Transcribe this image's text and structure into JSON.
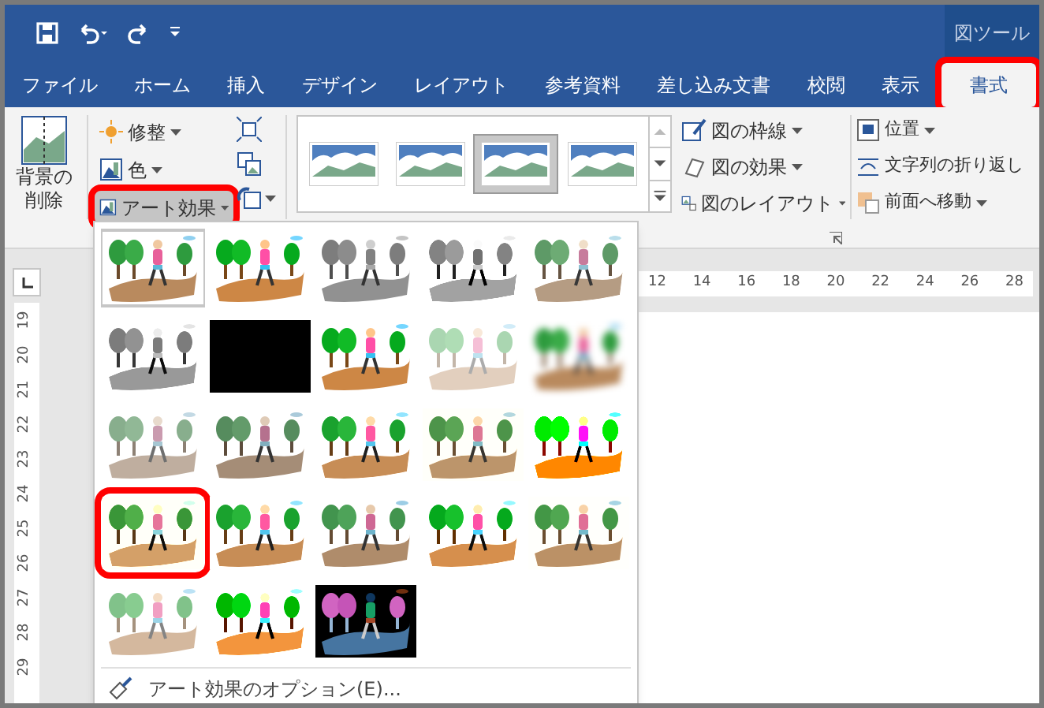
{
  "context_tab_group": "図ツール",
  "tabs": [
    {
      "label": "ファイル",
      "selected": false,
      "highlighted": false
    },
    {
      "label": "ホーム",
      "selected": false,
      "highlighted": false
    },
    {
      "label": "挿入",
      "selected": false,
      "highlighted": false
    },
    {
      "label": "デザイン",
      "selected": false,
      "highlighted": false
    },
    {
      "label": "レイアウト",
      "selected": false,
      "highlighted": false
    },
    {
      "label": "参考資料",
      "selected": false,
      "highlighted": false
    },
    {
      "label": "差し込み文書",
      "selected": false,
      "highlighted": false
    },
    {
      "label": "校閲",
      "selected": false,
      "highlighted": false
    },
    {
      "label": "表示",
      "selected": false,
      "highlighted": false
    },
    {
      "label": "書式",
      "selected": true,
      "highlighted": true
    }
  ],
  "ribbon": {
    "remove_background": [
      "背景の",
      "削除"
    ],
    "adjust": [
      {
        "label": "修整",
        "pressed": false,
        "highlighted": false
      },
      {
        "label": "色",
        "pressed": false,
        "highlighted": false
      },
      {
        "label": "アート効果",
        "pressed": true,
        "highlighted": true
      }
    ],
    "picture_styles": [
      {
        "selected": false
      },
      {
        "selected": false
      },
      {
        "selected": true
      },
      {
        "selected": false
      }
    ],
    "picture_commands": [
      "図の枠線",
      "図の効果",
      "図のレイアウト"
    ],
    "arrange": [
      "位置",
      "文字列の折り返し",
      "前面へ移動"
    ]
  },
  "ruler": {
    "horizontal": [
      "12",
      "14",
      "16",
      "18",
      "20",
      "22",
      "24",
      "26",
      "28"
    ],
    "vertical": [
      "19",
      "20",
      "21",
      "22",
      "23",
      "24",
      "25",
      "26",
      "27",
      "28",
      "29"
    ]
  },
  "art_effects_menu": {
    "items": [
      {
        "selected": true,
        "highlighted": false
      },
      {
        "selected": false,
        "highlighted": false
      },
      {
        "selected": false,
        "highlighted": false
      },
      {
        "selected": false,
        "highlighted": false
      },
      {
        "selected": false,
        "highlighted": false
      },
      {
        "selected": false,
        "highlighted": false
      },
      {
        "selected": false,
        "highlighted": false
      },
      {
        "selected": false,
        "highlighted": false
      },
      {
        "selected": false,
        "highlighted": false
      },
      {
        "selected": false,
        "highlighted": false
      },
      {
        "selected": false,
        "highlighted": false
      },
      {
        "selected": false,
        "highlighted": false
      },
      {
        "selected": false,
        "highlighted": false
      },
      {
        "selected": false,
        "highlighted": false
      },
      {
        "selected": false,
        "highlighted": false
      },
      {
        "selected": false,
        "highlighted": true
      },
      {
        "selected": false,
        "highlighted": false
      },
      {
        "selected": false,
        "highlighted": false
      },
      {
        "selected": false,
        "highlighted": false
      },
      {
        "selected": false,
        "highlighted": false
      },
      {
        "selected": false,
        "highlighted": false
      },
      {
        "selected": false,
        "highlighted": false
      },
      {
        "selected": false,
        "highlighted": false
      }
    ],
    "options_label": "アート効果のオプション(E)..."
  }
}
